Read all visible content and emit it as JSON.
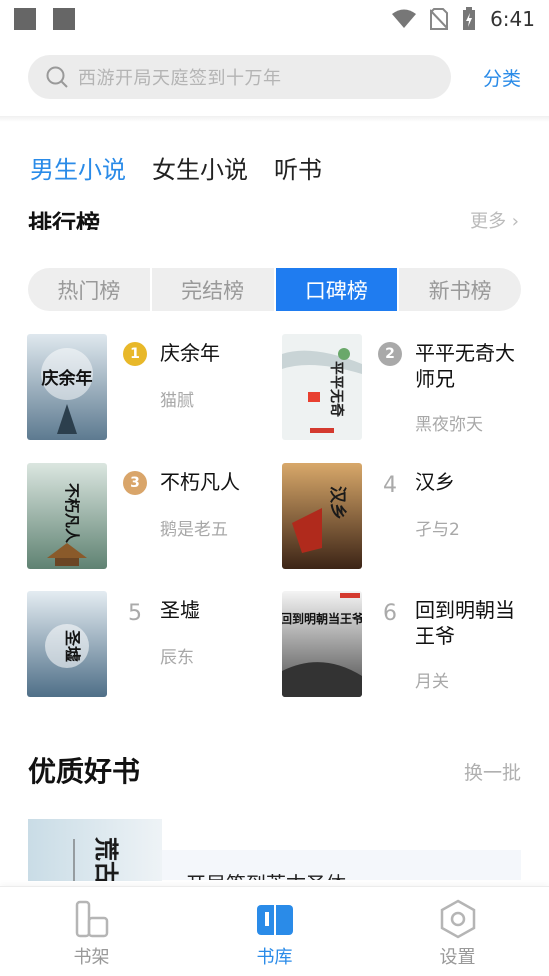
{
  "status_bar": {
    "time": "6:41"
  },
  "search": {
    "placeholder": "西游开局天庭签到十万年",
    "classify_label": "分类"
  },
  "gender_tabs": [
    {
      "label": "男生小说",
      "active": true
    },
    {
      "label": "女生小说",
      "active": false
    },
    {
      "label": "听书",
      "active": false
    }
  ],
  "ranking": {
    "title": "排行榜",
    "more": "更多 ›",
    "tabs": [
      {
        "label": "热门榜",
        "active": false
      },
      {
        "label": "完结榜",
        "active": false
      },
      {
        "label": "口碑榜",
        "active": true
      },
      {
        "label": "新书榜",
        "active": false
      }
    ],
    "books": [
      {
        "rank": "1",
        "title": "庆余年",
        "author": "猫腻",
        "cover_text": "庆余年",
        "cover_color": "#8fa6b8"
      },
      {
        "rank": "2",
        "title": "平平无奇大师兄",
        "author": "黑夜弥天",
        "cover_text": "平平无奇",
        "cover_color": "#e8eef0"
      },
      {
        "rank": "3",
        "title": "不朽凡人",
        "author": "鹅是老五",
        "cover_text": "不朽凡人",
        "cover_color": "#7a9a8c"
      },
      {
        "rank": "4",
        "title": "汉乡",
        "author": "孑与2",
        "cover_text": "汉乡",
        "cover_color": "#7a4a2a"
      },
      {
        "rank": "5",
        "title": "圣墟",
        "author": "辰东",
        "cover_text": "圣墟",
        "cover_color": "#6e8fa8"
      },
      {
        "rank": "6",
        "title": "回到明朝当王爷",
        "author": "月关",
        "cover_text": "回到明朝当王爷",
        "cover_color": "#b9b9b9"
      }
    ]
  },
  "quality": {
    "title": "优质好书",
    "swap_label": "换一批",
    "first_book": {
      "cover_text": "荒古",
      "title": "开局签到荒古圣体"
    }
  },
  "bottom_nav": [
    {
      "label": "书架",
      "icon": "bookshelf-icon",
      "active": false
    },
    {
      "label": "书库",
      "icon": "library-book-icon",
      "active": true
    },
    {
      "label": "设置",
      "icon": "settings-icon",
      "active": false
    }
  ],
  "colors": {
    "accent": "#2a8be8",
    "active_tab": "#1f7cf0",
    "gold": "#e8b829",
    "silver": "#a9a9a9",
    "bronze": "#d9a56a"
  }
}
